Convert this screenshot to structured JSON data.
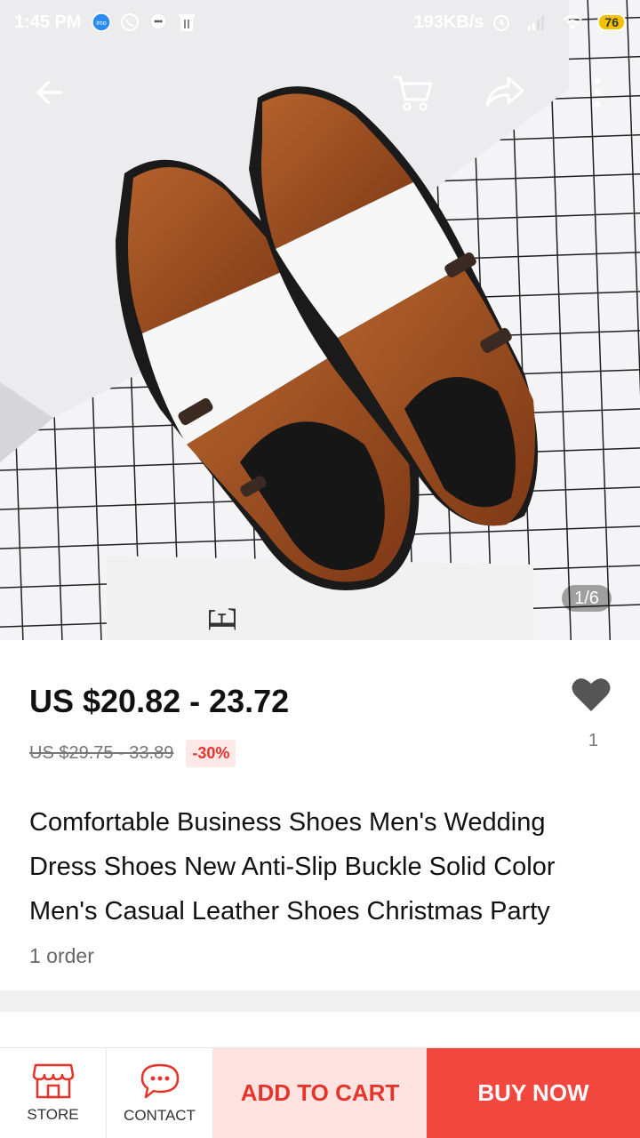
{
  "status_bar": {
    "time": "1:45 PM",
    "network_speed": "193KB/s",
    "battery": "76"
  },
  "gallery": {
    "counter": "1/6"
  },
  "product": {
    "price": "US $20.82 - 23.72",
    "original_price": "US $29.75 - 33.89",
    "discount": "-30%",
    "wishlist_count": "1",
    "title": "Comfortable Business Shoes Men's Wedding Dress Shoes New Anti-Slip Buckle Solid Color Men's Casual Leather Shoes Christmas Party",
    "orders": "1 order"
  },
  "bottom_bar": {
    "store_label": "STORE",
    "contact_label": "CONTACT",
    "add_to_cart_label": "ADD TO CART",
    "buy_now_label": "BUY NOW"
  },
  "colors": {
    "accent": "#f2473f",
    "accent_light": "#ffe3e1",
    "discount_text": "#e5352b"
  }
}
